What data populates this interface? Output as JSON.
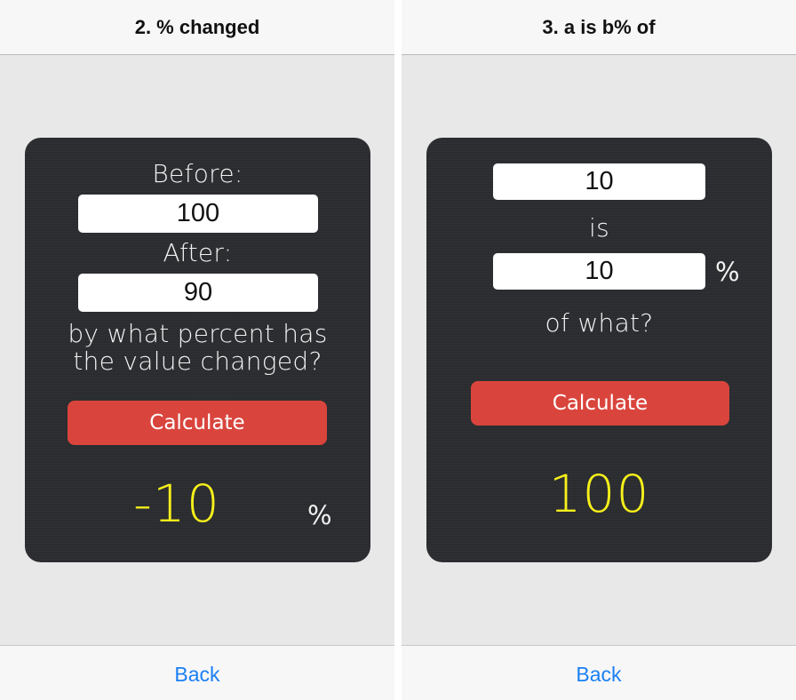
{
  "left_screen": {
    "title": "2. % changed",
    "before_label": "Before:",
    "before_value": "100",
    "after_label": "After:",
    "after_value": "90",
    "question_line1": "by what percent has",
    "question_line2": "the value changed?",
    "calculate_label": "Calculate",
    "result": "-10",
    "percent_sign": "%",
    "back_label": "Back"
  },
  "right_screen": {
    "title": "3. a is b% of",
    "a_value": "10",
    "is_label": "is",
    "b_value": "10",
    "percent_sign": "%",
    "of_what_label": "of what?",
    "calculate_label": "Calculate",
    "result": "100",
    "back_label": "Back"
  },
  "colors": {
    "card_background": "#2b2d30",
    "calculate_button": "#d9453d",
    "result_text": "#f5ef1b",
    "link": "#1a7ff5",
    "screen_background": "#e8e8e8"
  }
}
